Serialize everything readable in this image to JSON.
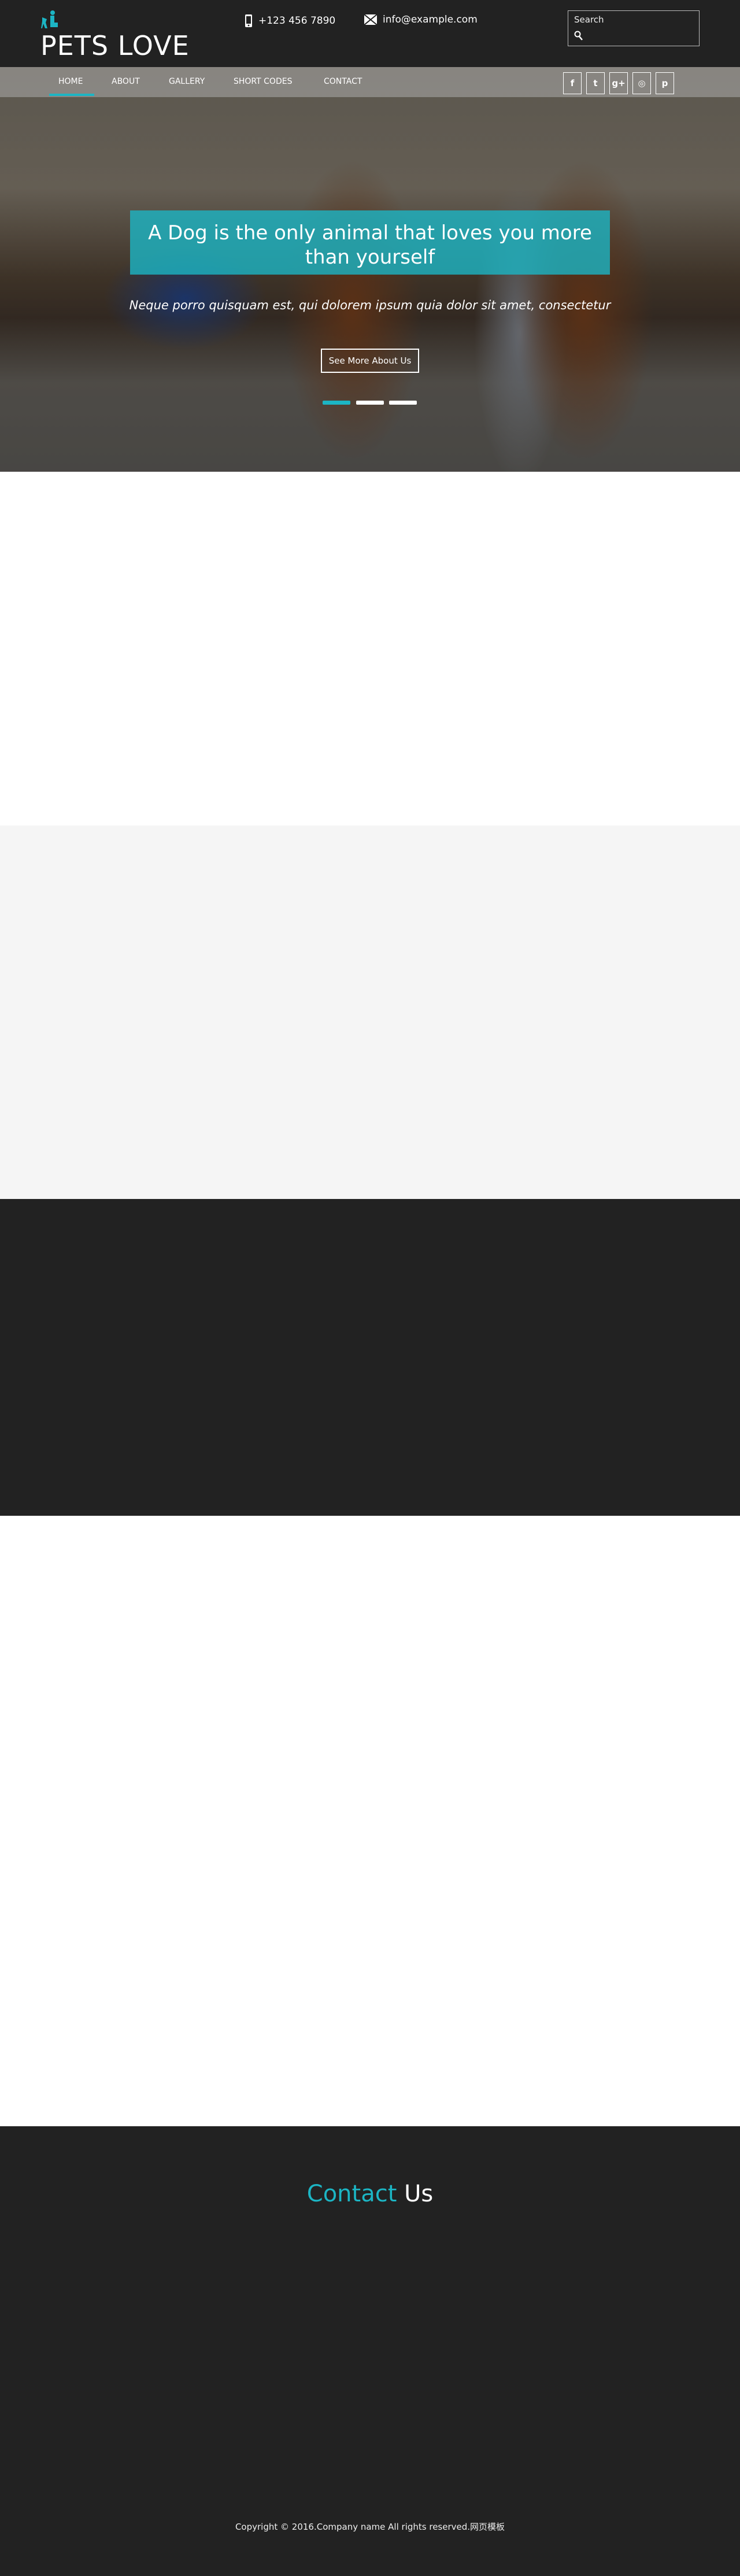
{
  "header": {
    "brand": "PETS LOVE",
    "phone": "+123 456 7890",
    "email": "info@example.com",
    "search_label": "Search"
  },
  "nav": {
    "items": [
      {
        "label": "Home",
        "active": true
      },
      {
        "label": "About"
      },
      {
        "label": "Gallery"
      },
      {
        "label": "Short Codes"
      },
      {
        "label": "Contact"
      }
    ],
    "social": [
      "facebook-icon",
      "twitter-icon",
      "google-plus-icon",
      "dribbble-icon",
      "pinterest-icon"
    ]
  },
  "hero": {
    "title": "A Dog is the only animal that loves you more than yourself",
    "subtitle": "Neque porro quisquam est, qui dolorem ipsum quia dolor sit amet, consectetur",
    "button": "See More About Us",
    "slides": 3,
    "active_slide": 1
  },
  "contact": {
    "title_accent": "Contact",
    "title_rest": "Us"
  },
  "footer": {
    "copyright": "Copyright © 2016.Company name All rights reserved.网页模板"
  },
  "colors": {
    "accent": "#1cb5c4",
    "dark": "#222222",
    "light": "#f5f5f5"
  }
}
